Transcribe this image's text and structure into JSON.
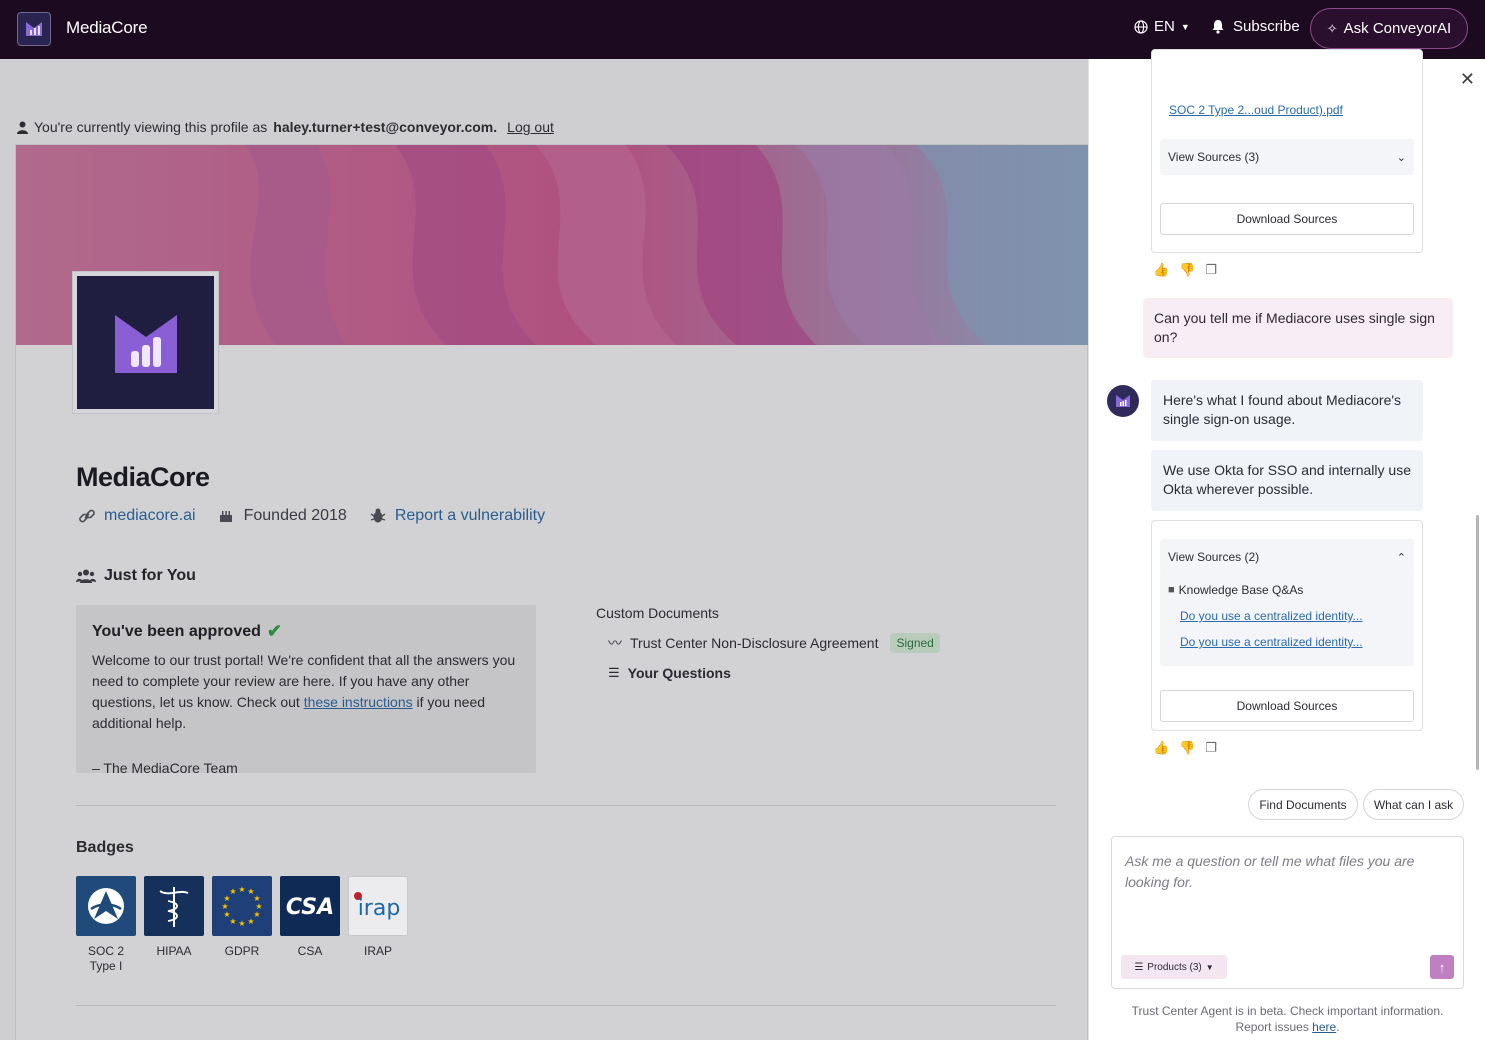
{
  "nav": {
    "brand": "MediaCore",
    "lang": "EN",
    "subscribe": "Subscribe",
    "ask": "Ask ConveyorAI"
  },
  "main": {
    "viewing_prefix": "You're currently viewing this profile as",
    "viewing_email": "haley.turner+test@conveyor.com.",
    "logout": "Log out",
    "company": "MediaCore",
    "website": "mediacore.ai",
    "founded": "Founded 2018",
    "report": "Report a vulnerability",
    "just_for_you": "Just for You",
    "approved_title": "You've been approved",
    "approved_body_1": "Welcome to our trust portal! We're confident that all the answers you need to complete your review are here. If you have any other questions, let us know. Check out",
    "approved_link": "these instructions",
    "approved_body_2": "if you need additional help.",
    "approved_sig": "– The MediaCore Team",
    "custom_docs_title": "Custom Documents",
    "nda": "Trust Center Non-Disclosure Agreement",
    "signed": "Signed",
    "your_questions": "Your Questions",
    "badges_title": "Badges",
    "badges": [
      {
        "label": "SOC 2 Type I",
        "color": "#1f4a7a"
      },
      {
        "label": "HIPAA",
        "color": "#15305a"
      },
      {
        "label": "GDPR",
        "color": "#1e3f78"
      },
      {
        "label": "CSA",
        "color": "#0f2a55"
      },
      {
        "label": "IRAP",
        "color": "#ececef"
      }
    ]
  },
  "panel": {
    "first_source_file": "SOC 2 Type 2...oud Product).pdf",
    "view_sources_1": "View Sources (3)",
    "download_sources": "Download Sources",
    "user_question": "Can you tell me if Mediacore uses single sign on?",
    "bot_intro": "Here's what I found about Mediacore's single sign-on usage.",
    "bot_answer": "We use Okta for SSO and internally use Okta wherever possible.",
    "view_sources_2": "View Sources (2)",
    "kb_title": "Knowledge Base Q&As",
    "kb_links": [
      "Do you use a centralized identity...",
      "Do you use a centralized identity..."
    ],
    "chip_find": "Find Documents",
    "chip_what": "What can I ask",
    "composer_placeholder": "Ask me a question or tell me what files you are looking for.",
    "products": "Products (3)",
    "disclaimer": "Trust Center Agent is in beta. Check important information. Report issues",
    "disclaimer_link": "here",
    "disclaimer_end": "."
  },
  "colors": {
    "nav_bg": "#1c0a20",
    "accent": "#c07fc0",
    "link": "#2a5d8f"
  }
}
